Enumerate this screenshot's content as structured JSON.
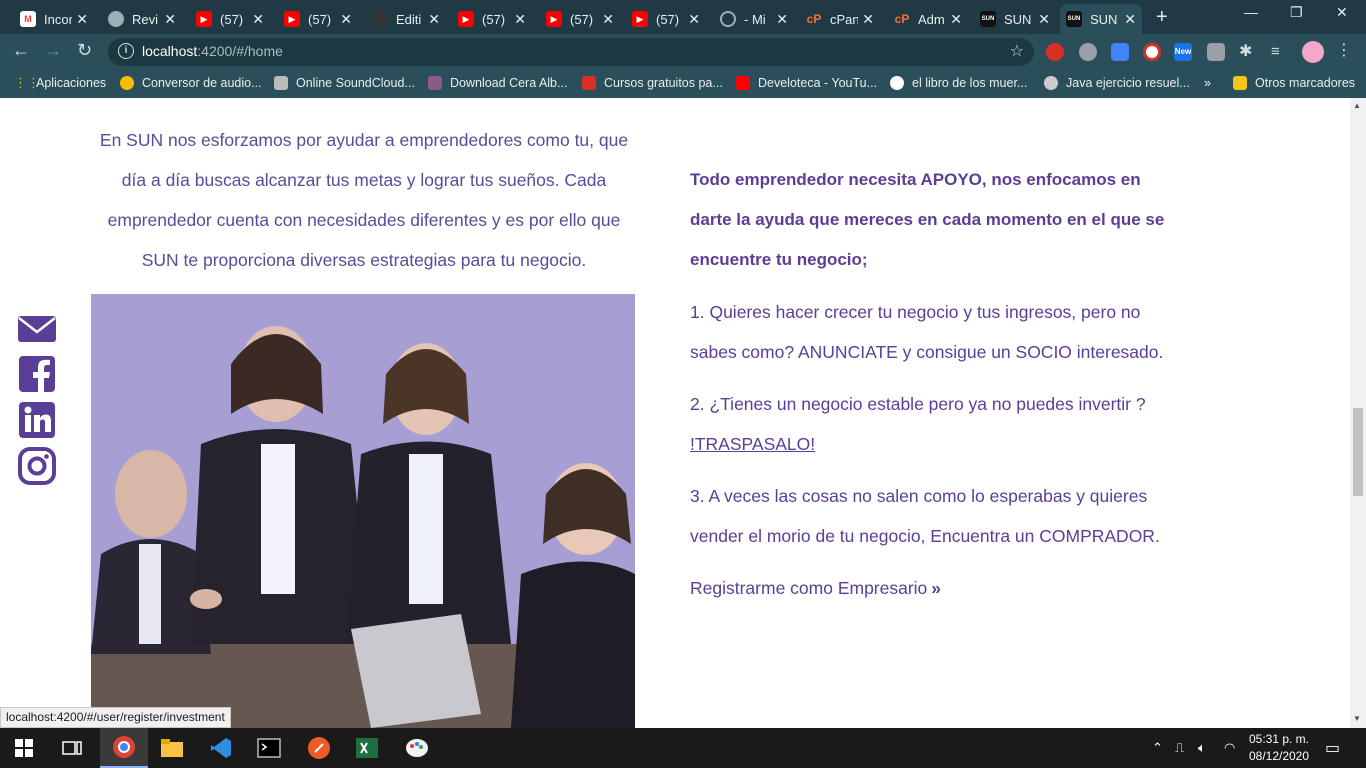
{
  "tabs": [
    {
      "title": "Incor",
      "icon": "gmail-icon",
      "color": "#ea4335"
    },
    {
      "title": "Revi",
      "icon": "globe-icon",
      "color": "#9ab0b6"
    },
    {
      "title": "(57)",
      "icon": "youtube-icon",
      "color": "#ff0000"
    },
    {
      "title": "(57)",
      "icon": "youtube-icon",
      "color": "#ff0000"
    },
    {
      "title": "Editi",
      "icon": "github-icon",
      "color": "#333333"
    },
    {
      "title": "(57)",
      "icon": "youtube-icon",
      "color": "#ff0000"
    },
    {
      "title": "(57)",
      "icon": "youtube-icon",
      "color": "#ff0000"
    },
    {
      "title": "(57)",
      "icon": "youtube-icon",
      "color": "#ff0000"
    },
    {
      "title": "- Mi",
      "icon": "spiral-icon",
      "color": "#9ab0b6"
    },
    {
      "title": "cPan",
      "icon": "cpanel-icon",
      "color": "#ff6c2c"
    },
    {
      "title": "Adm",
      "icon": "cpanel-icon",
      "color": "#ff6c2c"
    },
    {
      "title": "SUN",
      "icon": "sun-icon",
      "color": "#111111"
    },
    {
      "title": "SUN",
      "icon": "sun-icon",
      "color": "#111111"
    }
  ],
  "address": {
    "host": "localhost",
    "path": ":4200/#/home"
  },
  "bookmarks": [
    {
      "label": "Aplicaciones",
      "color": "#f4b400"
    },
    {
      "label": "Conversor de audio...",
      "color": "#fbbc05"
    },
    {
      "label": "Online SoundCloud...",
      "color": "#bbbbbb"
    },
    {
      "label": "Download Cera Alb...",
      "color": "#8a5a8a"
    },
    {
      "label": "Cursos gratuitos pa...",
      "color": "#d93025"
    },
    {
      "label": "Develoteca - YouTu...",
      "color": "#ff0000"
    },
    {
      "label": "el libro de los muer...",
      "color": "#ffffff"
    },
    {
      "label": "Java ejercicio resuel...",
      "color": "#cccccc"
    },
    {
      "label": "Otros marcadores",
      "color": "#f5c518"
    }
  ],
  "bookmarks_more": "»",
  "ext_new_badge": "New",
  "intro": {
    "text": "En SUN nos esforzamos por ayudar a emprendedores como tu, que día a día buscas alcanzar tus metas y lograr tus sueños. Cada emprendedor cuenta con necesidades diferentes y es por ello que SUN te proporciona diversas estrategias para tu negocio."
  },
  "right": {
    "lead": "Todo emprendedor necesita APOYO, nos enfocamos en darte la ayuda que mereces en cada momento en el que se encuentre tu negocio;",
    "item1": "1. Quieres hacer crecer tu negocio y tus ingresos, pero no sabes como? ANUNCIATE y consigue un SOCIO interesado.",
    "item2_text": "2. ¿Tienes un negocio estable pero ya no puedes invertir ? ",
    "item2_link": "!TRASPASALO!",
    "item3": "3. A veces las cosas no salen como lo esperabas y quieres vender el morio de tu negocio, Encuentra un COMPRADOR.",
    "register_link": "Registrarme como Empresario",
    "register_chevron": "»"
  },
  "status_url": "localhost:4200/#/user/register/investment",
  "clock": {
    "time": "05:31 p. m.",
    "date": "08/12/2020"
  },
  "colors": {
    "brand_purple": "#5b3e96",
    "text_purple": "#5b4a9a",
    "photo_tint": "#a89ed2",
    "chrome": "#2b4f5a"
  }
}
